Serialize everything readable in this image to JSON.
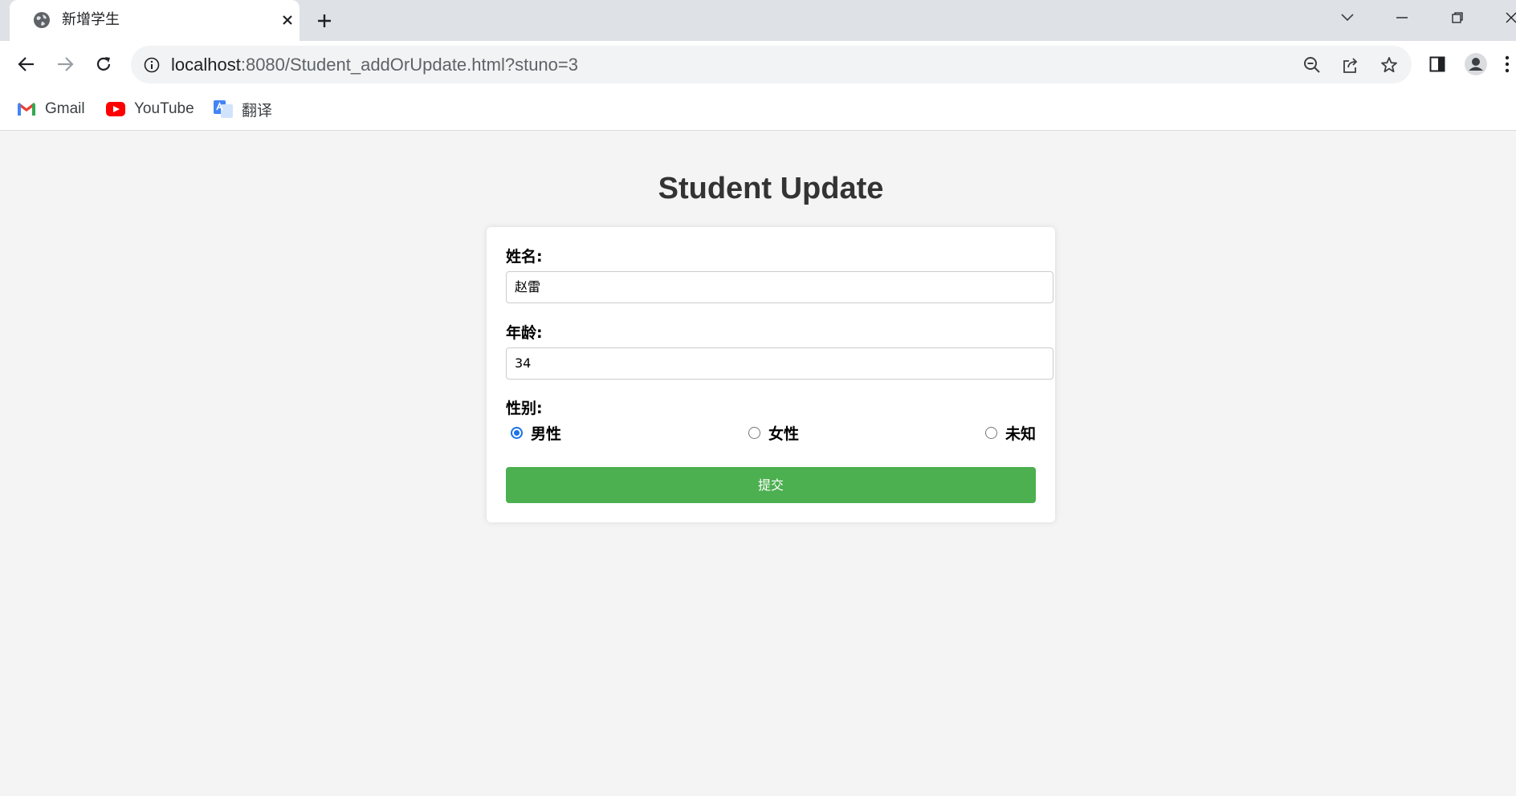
{
  "tab": {
    "title": "新增学生"
  },
  "address": {
    "host": "localhost",
    "path": ":8080/Student_addOrUpdate.html?stuno=3"
  },
  "bookmarks": [
    {
      "label": "Gmail",
      "icon": "gmail-icon"
    },
    {
      "label": "YouTube",
      "icon": "youtube-icon"
    },
    {
      "label": "翻译",
      "icon": "google-translate-icon"
    }
  ],
  "page": {
    "title": "Student Update"
  },
  "form": {
    "name_label": "姓名:",
    "name_value": "赵雷",
    "age_label": "年龄:",
    "age_value": "34",
    "gender_label": "性别:",
    "gender_options": [
      {
        "label": "男性",
        "checked": true
      },
      {
        "label": "女性",
        "checked": false
      },
      {
        "label": "未知",
        "checked": false
      }
    ],
    "submit_label": "提交"
  },
  "colors": {
    "accent": "#4caf50",
    "radio": "#1a73e8",
    "background": "#f4f4f4"
  }
}
